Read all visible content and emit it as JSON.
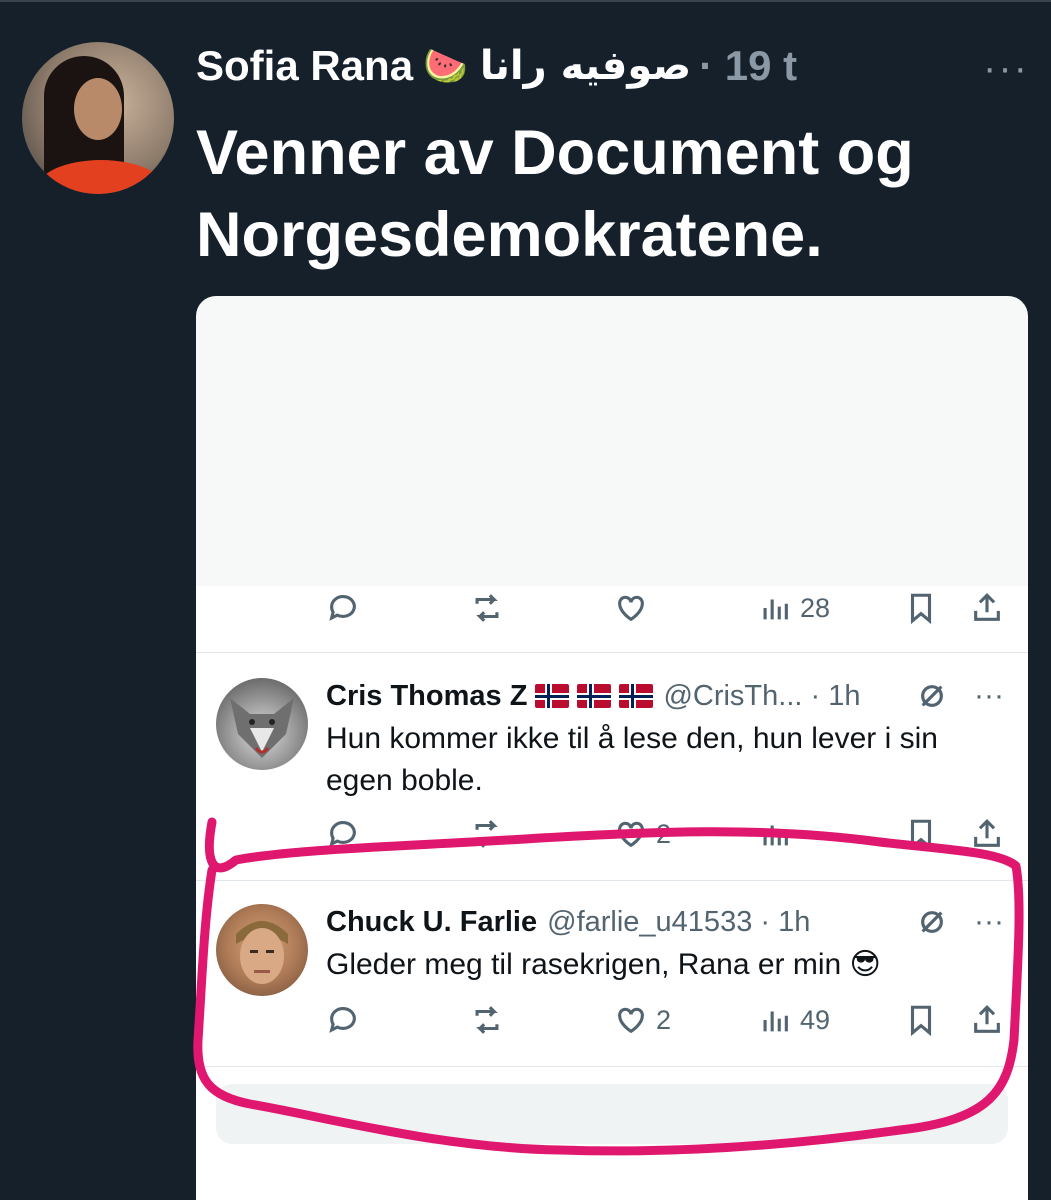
{
  "tweet": {
    "author_name": "Sofia Rana",
    "author_emoji": "🍉",
    "author_name_arabic": "صوفيه رانا",
    "time": "· 19 t",
    "more_label": "···",
    "text": "Venner av Document og Norgesdemokratene."
  },
  "screenshot": {
    "top_tweet_actions": {
      "views": "28"
    },
    "replies": [
      {
        "name": "Cris Thomas Z",
        "flags": [
          "norway-flag",
          "norway-flag",
          "norway-flag"
        ],
        "handle": "@CrisTh... · 1h",
        "text": "Hun kommer ikke til å lese den, hun lever i sin egen boble.",
        "likes": "2",
        "views": ""
      },
      {
        "name": "Chuck U. Farlie",
        "handle": "@farlie_u41533 · 1h",
        "text": "Gleder meg til rasekrigen, Rana er min 😎",
        "likes": "2",
        "views": "49"
      }
    ]
  },
  "colors": {
    "background": "#15202b",
    "highlight_marker": "#e0176f",
    "secondary_text": "#8b98a5"
  },
  "icons": [
    "reply-icon",
    "retweet-icon",
    "like-icon",
    "views-icon",
    "bookmark-icon",
    "share-icon",
    "grok-icon",
    "more-icon"
  ]
}
